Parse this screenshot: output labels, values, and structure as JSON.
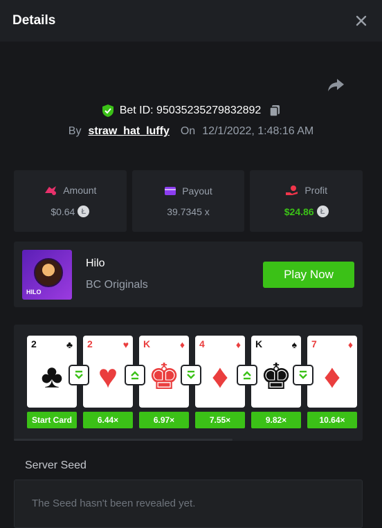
{
  "header": {
    "title": "Details"
  },
  "bet": {
    "id_label": "Bet ID: 95035235279832892",
    "by_label": "By",
    "username": "straw_hat_luffy",
    "on_label": "On",
    "datetime": "12/1/2022, 1:48:16 AM"
  },
  "stats": {
    "amount": {
      "label": "Amount",
      "value": "$0.64",
      "icon": "bet-chip-icon"
    },
    "payout": {
      "label": "Payout",
      "value": "39.7345 x",
      "icon": "wallet-icon"
    },
    "profit": {
      "label": "Profit",
      "value": "$24.86",
      "icon": "hand-coin-icon"
    },
    "coin_glyph": "Ł"
  },
  "game": {
    "name": "Hilo",
    "provider": "BC Originals",
    "thumb_tag": "HILO",
    "play_label": "Play Now"
  },
  "cards": [
    {
      "rank": "2",
      "suit": "♣",
      "color": "black",
      "face": false,
      "label": "Start Card"
    },
    {
      "rank": "2",
      "suit": "♥",
      "color": "red",
      "face": false,
      "label": "6.44×"
    },
    {
      "rank": "K",
      "suit": "♦",
      "color": "red",
      "face": true,
      "label": "6.97×"
    },
    {
      "rank": "4",
      "suit": "♦",
      "color": "red",
      "face": false,
      "label": "7.55×"
    },
    {
      "rank": "K",
      "suit": "♠",
      "color": "black",
      "face": true,
      "label": "9.82×"
    },
    {
      "rank": "7",
      "suit": "♦",
      "color": "red",
      "face": false,
      "label": "10.64×"
    }
  ],
  "arrows": [
    "down",
    "up",
    "down",
    "up",
    "down"
  ],
  "seed": {
    "label": "Server Seed",
    "placeholder": "The Seed hasn't been revealed yet."
  },
  "colors": {
    "accent_green": "#3bc117",
    "card_red": "#ea3e3e",
    "panel": "#202226"
  }
}
